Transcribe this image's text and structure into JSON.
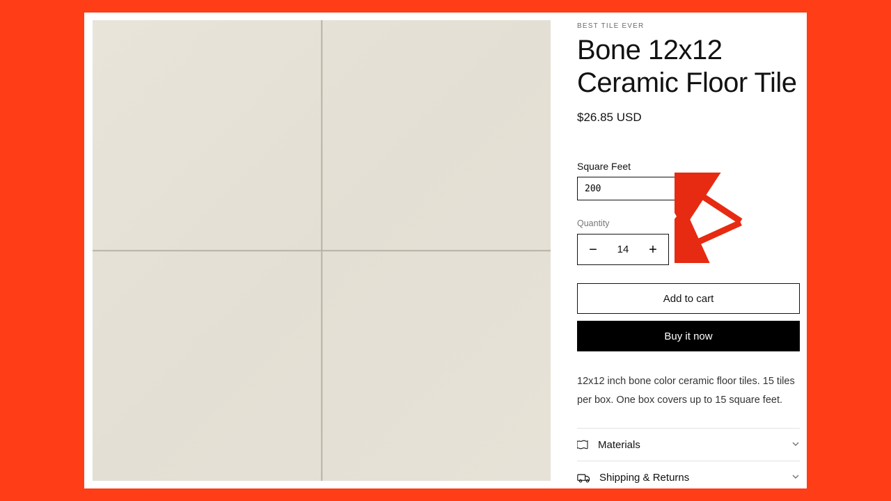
{
  "product": {
    "vendor": "BEST TILE EVER",
    "title": "Bone 12x12 Ceramic Floor Tile",
    "price": "$26.85 USD",
    "description": "12x12 inch bone color ceramic floor tiles.  15 tiles per box.  One box covers up to 15 square feet."
  },
  "sqft": {
    "label": "Square Feet",
    "value": "200"
  },
  "quantity": {
    "label": "Quantity",
    "value": "14",
    "minus": "−",
    "plus": "+"
  },
  "buttons": {
    "add_to_cart": "Add to cart",
    "buy_now": "Buy it now"
  },
  "accordion": {
    "materials": "Materials",
    "shipping": "Shipping & Returns"
  },
  "colors": {
    "accent": "#ff3d17",
    "annotation": "#e62b12"
  }
}
